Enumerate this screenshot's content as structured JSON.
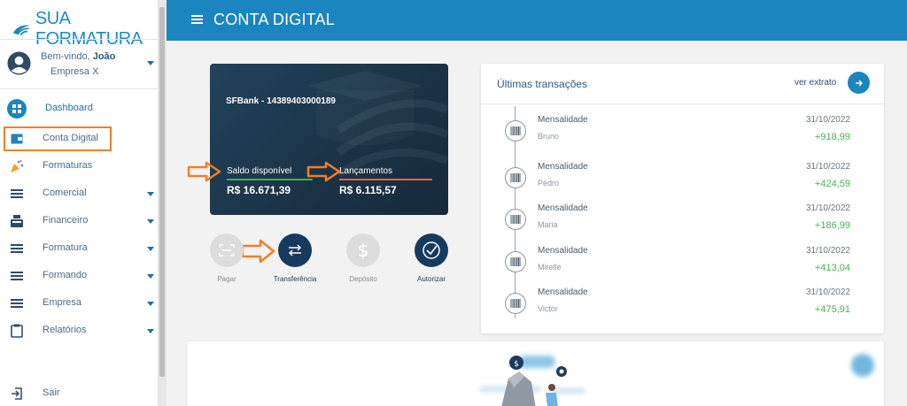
{
  "brand": {
    "logo_text": "SUA FORMATURA",
    "color": "#1a85bf"
  },
  "user": {
    "welcome_prefix": "Bem-vindo,",
    "name": "João",
    "company": "Empresa X"
  },
  "nav": {
    "dashboard": "Dashboard",
    "conta_digital": "Conta Digital",
    "formaturas": "Formaturas",
    "comercial": "Comercial",
    "financeiro": "Financeiro",
    "formatura": "Formatura",
    "formando": "Formando",
    "empresa": "Empresa",
    "relatorios": "Relatórios",
    "sair": "Sair"
  },
  "header": {
    "title": "CONTA DIGITAL"
  },
  "card": {
    "bank": "SFBank - 14389403000189",
    "saldo_label": "Saldo disponível",
    "saldo_value": "R$ 16.671,39",
    "lanc_label": "Lançamentos",
    "lanc_value": "R$ 6.115,57"
  },
  "actions": {
    "pagar": "Pagar",
    "transferencia": "Transferência",
    "deposito": "Depósito",
    "autorizar": "Autorizar"
  },
  "transactions": {
    "title": "Últimas transações",
    "link": "ver extrato",
    "items": [
      {
        "type": "Mensalidade",
        "name": "Bruno",
        "date": "31/10/2022",
        "value": "+918,99"
      },
      {
        "type": "Mensalidade",
        "name": "Pedro",
        "date": "31/10/2022",
        "value": "+424,59"
      },
      {
        "type": "Mensalidade",
        "name": "Maria",
        "date": "31/10/2022",
        "value": "+186,99"
      },
      {
        "type": "Mensalidade",
        "name": "Mirelle",
        "date": "31/10/2022",
        "value": "+413,04"
      },
      {
        "type": "Mensalidade",
        "name": "Victor",
        "date": "31/10/2022",
        "value": "+475,91"
      }
    ]
  }
}
